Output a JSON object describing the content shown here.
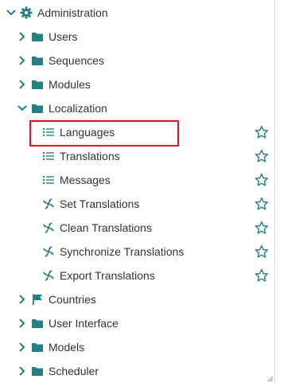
{
  "tree": {
    "root": {
      "label": "Administration",
      "expanded": true,
      "icon": "gear-icon"
    },
    "items": [
      {
        "label": "Users",
        "icon": "folder-icon",
        "expanded": false
      },
      {
        "label": "Sequences",
        "icon": "folder-icon",
        "expanded": false
      },
      {
        "label": "Modules",
        "icon": "folder-icon",
        "expanded": false
      },
      {
        "label": "Localization",
        "icon": "folder-icon",
        "expanded": true,
        "children": [
          {
            "label": "Languages",
            "icon": "list-icon",
            "favorite": false,
            "highlighted": true
          },
          {
            "label": "Translations",
            "icon": "list-icon",
            "favorite": false
          },
          {
            "label": "Messages",
            "icon": "list-icon",
            "favorite": false
          },
          {
            "label": "Set Translations",
            "icon": "wizard-icon",
            "favorite": false
          },
          {
            "label": "Clean Translations",
            "icon": "wizard-icon",
            "favorite": false
          },
          {
            "label": "Synchronize Translations",
            "icon": "wizard-icon",
            "favorite": false
          },
          {
            "label": "Export Translations",
            "icon": "wizard-icon",
            "favorite": false
          }
        ]
      },
      {
        "label": "Countries",
        "icon": "flag-icon",
        "expanded": false
      },
      {
        "label": "User Interface",
        "icon": "folder-icon",
        "expanded": false
      },
      {
        "label": "Models",
        "icon": "folder-icon",
        "expanded": false
      },
      {
        "label": "Scheduler",
        "icon": "folder-icon",
        "expanded": false
      }
    ]
  },
  "colors": {
    "accent": "#267f82",
    "text": "#333333",
    "chevron": "#267f82",
    "highlight_border": "#e8101b"
  }
}
